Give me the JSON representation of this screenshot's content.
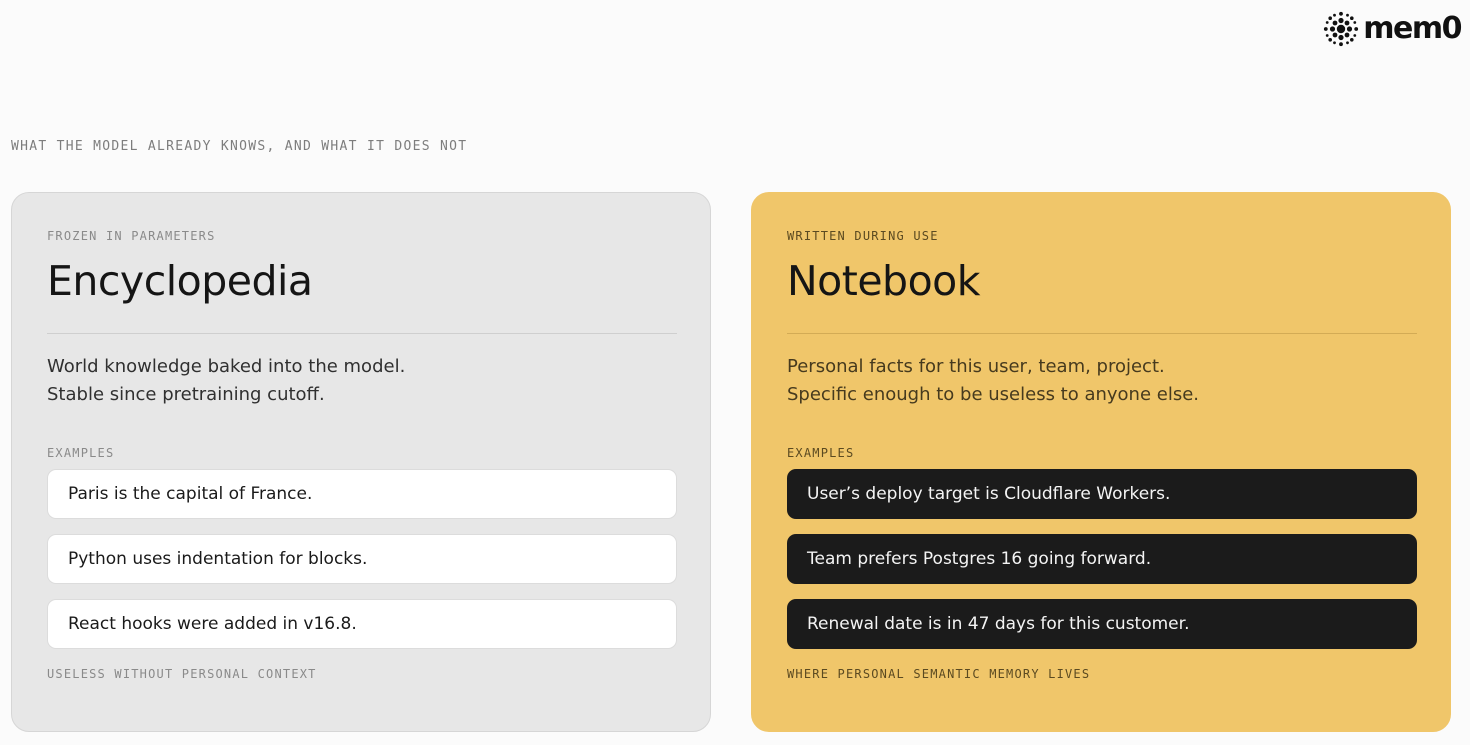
{
  "logo": {
    "text": "mem0",
    "icon": "mem0-logo-icon"
  },
  "eyebrow": "WHAT THE MODEL ALREADY KNOWS, AND WHAT IT DOES NOT",
  "colors": {
    "page_bg": "#fbfbfb",
    "left_card_bg": "#e7e7e7",
    "right_card_bg": "#f0c66a",
    "dark_pill": "#1b1b1b"
  },
  "cards": [
    {
      "kicker": "FROZEN IN PARAMETERS",
      "title": "Encyclopedia",
      "description": [
        "World knowledge baked into the model.",
        "Stable since pretraining cutoff."
      ],
      "examples_label": "EXAMPLES",
      "examples": [
        "Paris is the capital of France.",
        "Python uses indentation for blocks.",
        "React hooks were added in v16.8."
      ],
      "footer": "USELESS WITHOUT PERSONAL CONTEXT"
    },
    {
      "kicker": "WRITTEN DURING USE",
      "title": "Notebook",
      "description": [
        "Personal facts for this user, team, project.",
        "Specific enough to be useless to anyone else."
      ],
      "examples_label": "EXAMPLES",
      "examples": [
        "User’s deploy target is Cloudflare Workers.",
        "Team prefers Postgres 16 going forward.",
        "Renewal date is in 47 days for this customer."
      ],
      "footer": "WHERE PERSONAL SEMANTIC MEMORY LIVES"
    }
  ]
}
